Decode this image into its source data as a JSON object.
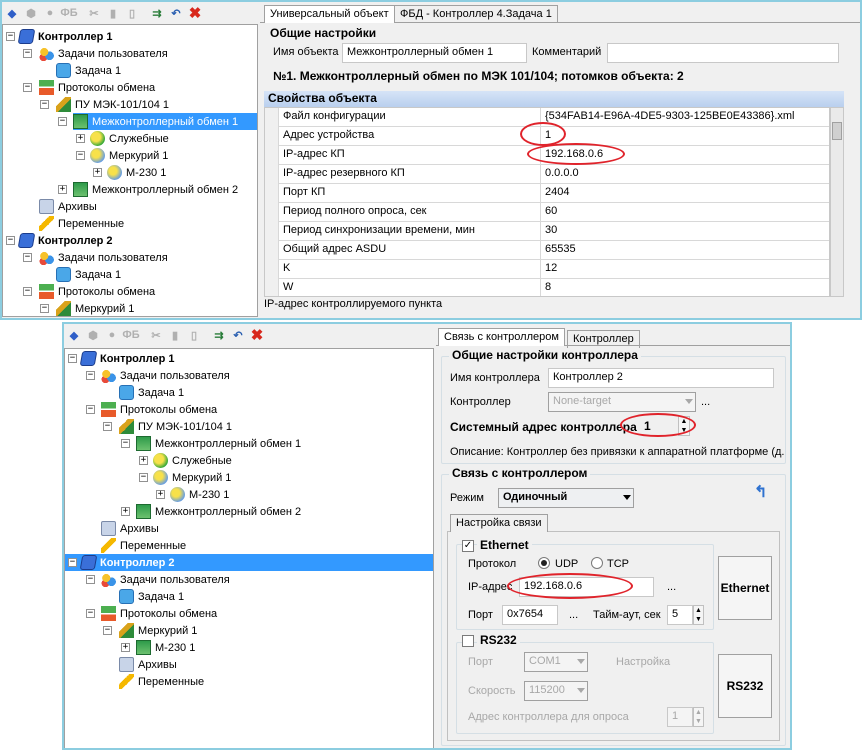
{
  "top": {
    "toolbar_icons": [
      "controller-add-icon",
      "shape-icon",
      "shape2-icon",
      "fb-icon",
      "cut-icon",
      "delete-icon",
      "page-icon",
      "export-icon",
      "undo-icon",
      "close-icon"
    ],
    "toolbar_fb": "ФБ",
    "tree": [
      {
        "label": "Контроллер 1",
        "bold": true
      },
      {
        "label": "Задачи пользователя"
      },
      {
        "label": "Задача 1"
      },
      {
        "label": "Протоколы обмена"
      },
      {
        "label": "ПУ МЭК-101/104 1"
      },
      {
        "label": "Межконтроллерный обмен 1"
      },
      {
        "label": "Служебные"
      },
      {
        "label": "Меркурий 1"
      },
      {
        "label": "М-230 1"
      },
      {
        "label": "Межконтроллерный обмен 2"
      },
      {
        "label": "Архивы"
      },
      {
        "label": "Переменные"
      },
      {
        "label": "Контроллер 2",
        "bold": true
      },
      {
        "label": "Задачи пользователя"
      },
      {
        "label": "Задача 1"
      },
      {
        "label": "Протоколы обмена"
      },
      {
        "label": "Меркурий 1"
      }
    ],
    "tabs": [
      "Универсальный объект",
      "ФБД - Контроллер 4.Задача 1"
    ],
    "general_title": "Общие настройки",
    "name_label": "Имя объекта",
    "name_value": "Межконтроллерный обмен 1",
    "comment_label": "Комментарий",
    "comment_value": "",
    "summary": "№1. Межконтроллерный обмен по МЭК 101/104; потомков объекта: 2",
    "props_title": "Свойства объекта",
    "props": [
      {
        "k": "Файл конфигурации",
        "v": "{534FAB14-E96A-4DE5-9303-125BE0E43386}.xml"
      },
      {
        "k": "Адрес устройства",
        "v": "1"
      },
      {
        "k": "IP-адрес КП",
        "v": "192.168.0.6"
      },
      {
        "k": "IP-адрес резервного КП",
        "v": "0.0.0.0"
      },
      {
        "k": "Порт КП",
        "v": "2404"
      },
      {
        "k": "Период полного опроса, сек",
        "v": "60"
      },
      {
        "k": "Период синхронизации времени, мин",
        "v": "30"
      },
      {
        "k": "Общий адрес ASDU",
        "v": "65535"
      },
      {
        "k": "K",
        "v": "12"
      },
      {
        "k": "W",
        "v": "8"
      }
    ],
    "status": "IP-адрес контроллируемого пункта"
  },
  "bottom": {
    "toolbar_fb": "ФБ",
    "tree": [
      {
        "label": "Контроллер 1",
        "bold": true
      },
      {
        "label": "Задачи пользователя"
      },
      {
        "label": "Задача 1"
      },
      {
        "label": "Протоколы обмена"
      },
      {
        "label": "ПУ МЭК-101/104 1"
      },
      {
        "label": "Межконтроллерный обмен 1"
      },
      {
        "label": "Служебные"
      },
      {
        "label": "Меркурий 1"
      },
      {
        "label": "М-230 1"
      },
      {
        "label": "Межконтроллерный обмен 2"
      },
      {
        "label": "Архивы"
      },
      {
        "label": "Переменные"
      },
      {
        "label": "Контроллер 2",
        "bold": true
      },
      {
        "label": "Задачи пользователя"
      },
      {
        "label": "Задача 1"
      },
      {
        "label": "Протоколы обмена"
      },
      {
        "label": "Меркурий 1"
      },
      {
        "label": "М-230 1"
      },
      {
        "label": "Архивы"
      },
      {
        "label": "Переменные"
      }
    ],
    "tabs": [
      "Связь с контроллером",
      "Контроллер"
    ],
    "general_title": "Общие настройки контроллера",
    "ctrl_name_label": "Имя контроллера",
    "ctrl_name_value": "Контроллер 2",
    "ctrl_label": "Контроллер",
    "ctrl_value": "None-target",
    "ellipsis": "...",
    "sys_addr_label": "Системный адрес контроллера",
    "sys_addr_value": "1",
    "description": "Описание: Контроллер без привязки к аппаратной платформе (д.",
    "link_title": "Связь с контроллером",
    "mode_label": "Режим",
    "mode_value": "Одиночный",
    "link_tab": "Настройка связи",
    "eth_title": "Ethernet",
    "protocol_label": "Протокол",
    "udp": "UDP",
    "tcp": "TCP",
    "ip_label": "IP-адрес",
    "ip_value": "192.168.0.6",
    "port_label": "Порт",
    "port_value": "0x7654",
    "timeout_label": "Тайм-аут, сек",
    "timeout_value": "5",
    "eth_button": "Ethernet",
    "rs_title": "RS232",
    "rs_port_label": "Порт",
    "rs_port_value": "COM1",
    "rs_settings": "Настройка",
    "rs_speed_label": "Скорость",
    "rs_speed_value": "115200",
    "rs_addr_label": "Адрес контроллера для опроса",
    "rs_addr_value": "1",
    "rs_button": "RS232"
  }
}
